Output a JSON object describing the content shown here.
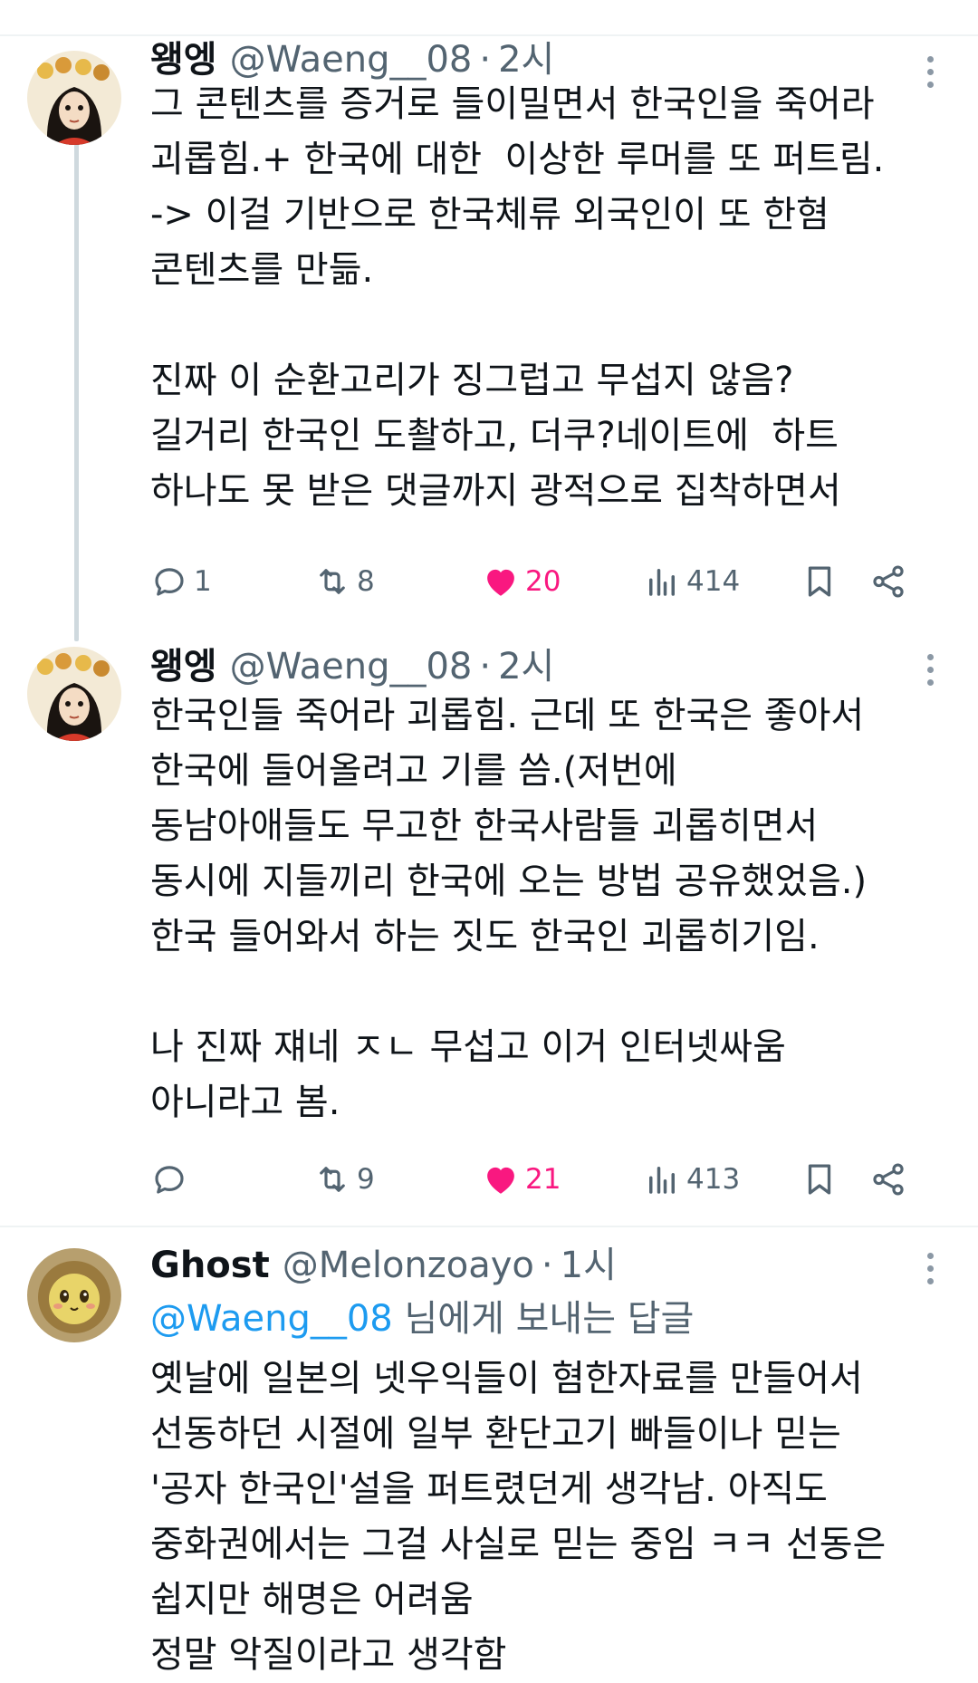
{
  "tweets": [
    {
      "name": "왱엥",
      "handle": "@Waeng__08",
      "separator": "·",
      "time": "2시",
      "avatar_icon": "anime-character-avatar",
      "lines": [
        "그 콘텐츠를 증거로 들이밀면서 한국인을 죽어라",
        "괴롭힘.+ 한국에 대한  이상한 루머를 또 퍼트림.",
        "-> 이걸 기반으로 한국체류 외국인이 또 한혐",
        "콘텐츠를 만듦.",
        "",
        "진짜 이 순환고리가 징그럽고 무섭지 않음?",
        "길거리 한국인 도촬하고, 더쿠?네이트에  하트",
        "하나도 못 받은 댓글까지 광적으로 집착하면서"
      ],
      "stats": {
        "replies": "1",
        "retweets": "8",
        "likes": "20",
        "views": "414"
      }
    },
    {
      "name": "왱엥",
      "handle": "@Waeng__08",
      "separator": "·",
      "time": "2시",
      "avatar_icon": "anime-character-avatar",
      "lines": [
        "한국인들 죽어라 괴롭힘. 근데 또 한국은 좋아서",
        "한국에 들어올려고 기를 씀.(저번에",
        "동남아애들도 무고한 한국사람들 괴롭히면서",
        "동시에 지들끼리 한국에 오는 방법 공유했었음.)",
        "한국 들어와서 하는 짓도 한국인 괴롭히기임.",
        "",
        "나 진짜 쟤네 ㅈㄴ 무섭고 이거 인터넷싸움",
        "아니라고 봄."
      ],
      "stats": {
        "replies": "",
        "retweets": "9",
        "likes": "21",
        "views": "413"
      }
    },
    {
      "name": "Ghost",
      "handle": "@Melonzoayo",
      "separator": "·",
      "time": "1시",
      "avatar_icon": "lion-plush-avatar",
      "reply_to": {
        "mention": "@Waeng__08",
        "suffix": " 님에게 보내는 답글"
      },
      "lines": [
        "옛날에 일본의 넷우익들이 혐한자료를 만들어서",
        "선동하던 시절에 일부 환단고기 빠들이나 믿는",
        "'공자 한국인'설을 퍼트렸던게 생각남. 아직도",
        "중화권에서는 그걸 사실로 믿는 중임 ㅋㅋ 선동은",
        "쉽지만 해명은 어려움",
        "정말 악질이라고 생각함"
      ]
    }
  ],
  "colors": {
    "text": "#0f1419",
    "secondary": "#536471",
    "like": "#f91880",
    "link": "#1d9bf0",
    "divider": "#eff3f4",
    "thread_line": "#cfd9de"
  }
}
